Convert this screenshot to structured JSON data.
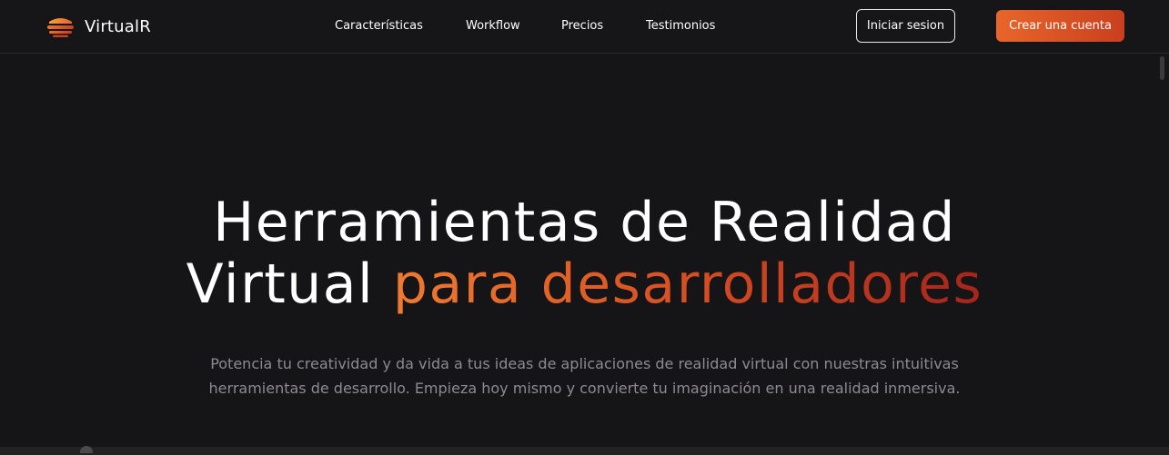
{
  "brand": {
    "name": "VirtualR",
    "logo_icon": "layered-stack-logo",
    "logo_colors": [
      "#f28a2e",
      "#e8662a",
      "#c8401f"
    ]
  },
  "nav": {
    "items": [
      {
        "label": "Características"
      },
      {
        "label": "Workflow"
      },
      {
        "label": "Precios"
      },
      {
        "label": "Testimonios"
      }
    ]
  },
  "header": {
    "login_label": "Iniciar sesion",
    "signup_label": "Crear una cuenta"
  },
  "hero": {
    "title_line1": "Herramientas de Realidad",
    "title_line2_plain": "Virtual",
    "title_line2_accent": "para desarrolladores",
    "subtitle": "Potencia tu creatividad y da vida a tus ideas de aplicaciones de realidad virtual con nuestras intuitivas herramientas de desarrollo. Empieza hoy mismo y convierte tu imaginación en una realidad inmersiva."
  },
  "colors": {
    "background": "#151416",
    "accent_start": "#f07a30",
    "accent_end": "#a5241c",
    "text": "#ffffff",
    "muted_text": "#8d8b90"
  }
}
